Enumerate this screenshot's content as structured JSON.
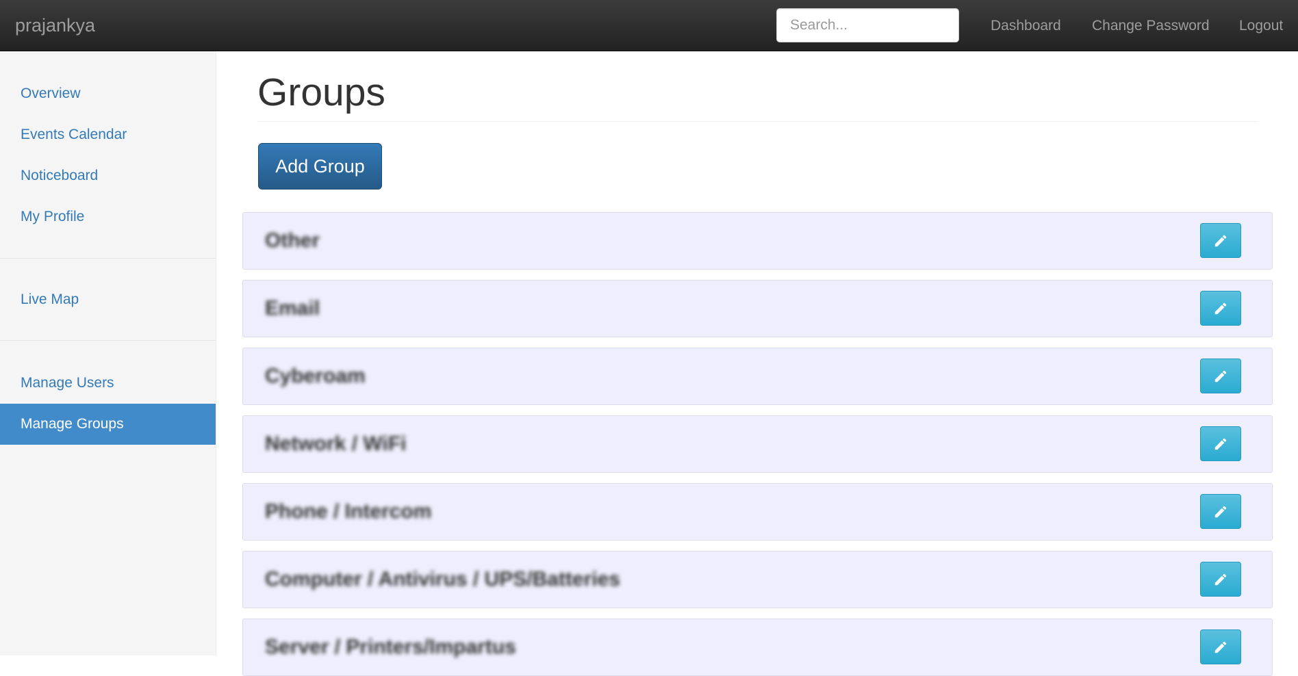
{
  "navbar": {
    "brand": "prajankya",
    "search_placeholder": "Search...",
    "links": {
      "dashboard": "Dashboard",
      "change_password": "Change Password",
      "logout": "Logout"
    }
  },
  "sidebar": {
    "items": [
      {
        "label": "Overview"
      },
      {
        "label": "Events Calendar"
      },
      {
        "label": "Noticeboard"
      },
      {
        "label": "My Profile"
      },
      {
        "label": "Live Map"
      },
      {
        "label": "Manage Users"
      },
      {
        "label": "Manage Groups",
        "active": true
      }
    ]
  },
  "main": {
    "title": "Groups",
    "add_group_label": "Add Group",
    "groups": [
      {
        "name": "Other"
      },
      {
        "name": "Email"
      },
      {
        "name": "Cyberoam"
      },
      {
        "name": "Network / WiFi"
      },
      {
        "name": "Phone / Intercom"
      },
      {
        "name": "Computer / Antivirus / UPS/Batteries"
      },
      {
        "name": "Server / Printers/Impartus"
      }
    ],
    "edit_icon": "pencil-icon"
  },
  "colors": {
    "navbar_bg": "#222222",
    "sidebar_active": "#428bca",
    "link": "#337ab7",
    "primary_button": "#286090",
    "info_button": "#31b0d5",
    "group_row_bg": "#eeeefc"
  }
}
